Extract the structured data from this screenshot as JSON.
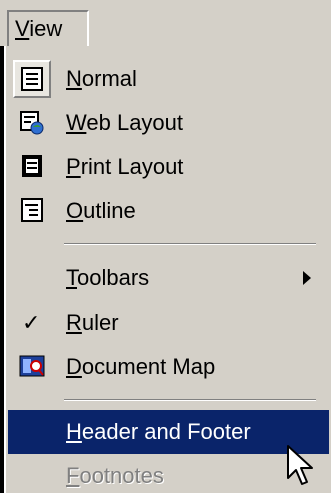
{
  "menubar": {
    "view_label": "View",
    "view_mnemonic": "V",
    "view_rest": "iew"
  },
  "menu": {
    "items": [
      {
        "label": "Normal",
        "mnemonic": "N",
        "rest": "ormal",
        "icon": "normal-view-icon",
        "checked_frame": true
      },
      {
        "label": "Web Layout",
        "mnemonic": "W",
        "rest": "eb Layout",
        "icon": "web-layout-icon"
      },
      {
        "label": "Print Layout",
        "mnemonic": "P",
        "rest": "rint Layout",
        "icon": "print-layout-icon"
      },
      {
        "label": "Outline",
        "mnemonic": "O",
        "rest": "utline",
        "icon": "outline-view-icon"
      },
      {
        "label": "Toolbars",
        "mnemonic": "T",
        "rest": "oolbars",
        "submenu": true
      },
      {
        "label": "Ruler",
        "mnemonic": "R",
        "rest": "uler",
        "checked": true,
        "check_glyph": "✓"
      },
      {
        "label": "Document Map",
        "mnemonic": "D",
        "rest": "ocument Map",
        "icon": "document-map-icon"
      },
      {
        "label": "Header and Footer",
        "mnemonic": "H",
        "rest": "eader and Footer",
        "highlighted": true
      },
      {
        "label": "Footnotes",
        "mnemonic": "F",
        "rest": "ootnotes",
        "disabled": true
      }
    ]
  },
  "colors": {
    "menu_bg": "#d4d0c8",
    "highlight": "#0a246a",
    "disabled_text": "#808080"
  }
}
